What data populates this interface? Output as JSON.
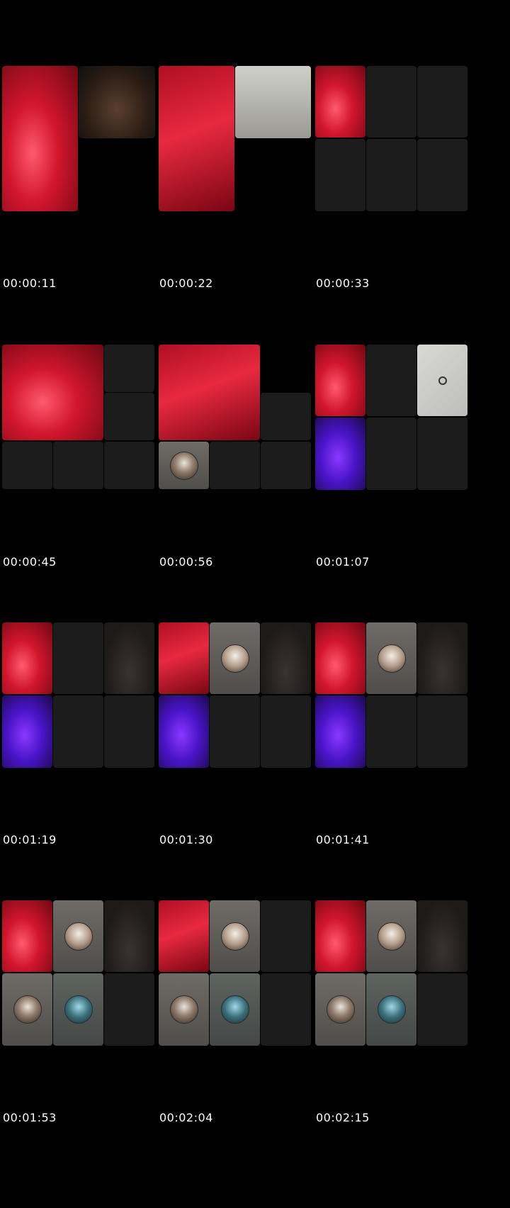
{
  "timestamps": {
    "t1": "00:00:11",
    "t2": "00:00:22",
    "t3": "00:00:33",
    "t4": "00:00:45",
    "t5": "00:00:56",
    "t6": "00:01:07",
    "t7": "00:01:19",
    "t8": "00:01:30",
    "t9": "00:01:41",
    "t10": "00:01:53",
    "t11": "00:02:04",
    "t12": "00:02:15"
  },
  "colors": {
    "background": "#000000",
    "empty_tile": "#1c1c1c",
    "timestamp_text": "#ffffff"
  }
}
